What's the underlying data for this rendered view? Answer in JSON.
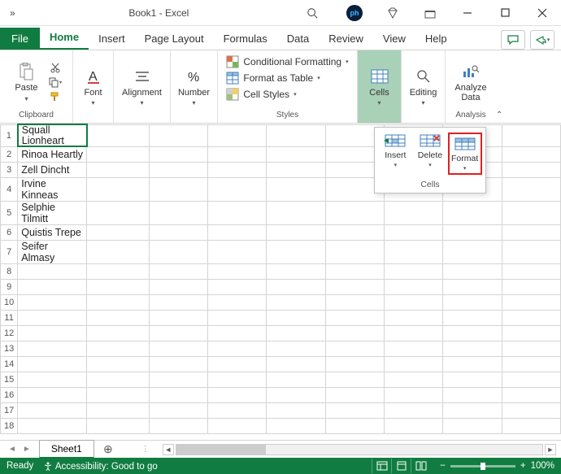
{
  "titlebar": {
    "title": "Book1  -  Excel",
    "qat_chevrons": "»"
  },
  "tabs": {
    "file": "File",
    "home": "Home",
    "insert": "Insert",
    "pagelayout": "Page Layout",
    "formulas": "Formulas",
    "data": "Data",
    "review": "Review",
    "view": "View",
    "help": "Help"
  },
  "ribbon": {
    "clipboard": {
      "paste": "Paste",
      "label": "Clipboard"
    },
    "font": {
      "btn": "Font",
      "label": "Font"
    },
    "alignment": {
      "btn": "Alignment",
      "label": "Alignment"
    },
    "number": {
      "btn": "Number",
      "label": "Number"
    },
    "styles": {
      "cond": "Conditional Formatting",
      "table": "Format as Table",
      "cell": "Cell Styles",
      "label": "Styles"
    },
    "cells": {
      "btn": "Cells",
      "label": "Cells"
    },
    "editing": {
      "btn": "Editing",
      "label": "Editing"
    },
    "analysis": {
      "btn": "Analyze\nData",
      "label": "Analysis"
    }
  },
  "popover": {
    "insert": "Insert",
    "delete": "Delete",
    "format": "Format",
    "label": "Cells"
  },
  "sheet": {
    "rows": [
      "Squall Lionheart",
      "Rinoa Heartly",
      "Zell Dincht",
      "Irvine Kinneas",
      "Selphie Tilmitt",
      "Quistis Trepe",
      "Seifer Almasy"
    ],
    "row_headers": [
      "1",
      "2",
      "3",
      "4",
      "5",
      "6",
      "7",
      "8",
      "9",
      "10",
      "11",
      "12",
      "13",
      "14",
      "15",
      "16",
      "17",
      "18"
    ]
  },
  "sheettabs": {
    "name": "Sheet1"
  },
  "status": {
    "ready": "Ready",
    "accessibility": "Accessibility: Good to go",
    "zoom": "100%"
  }
}
